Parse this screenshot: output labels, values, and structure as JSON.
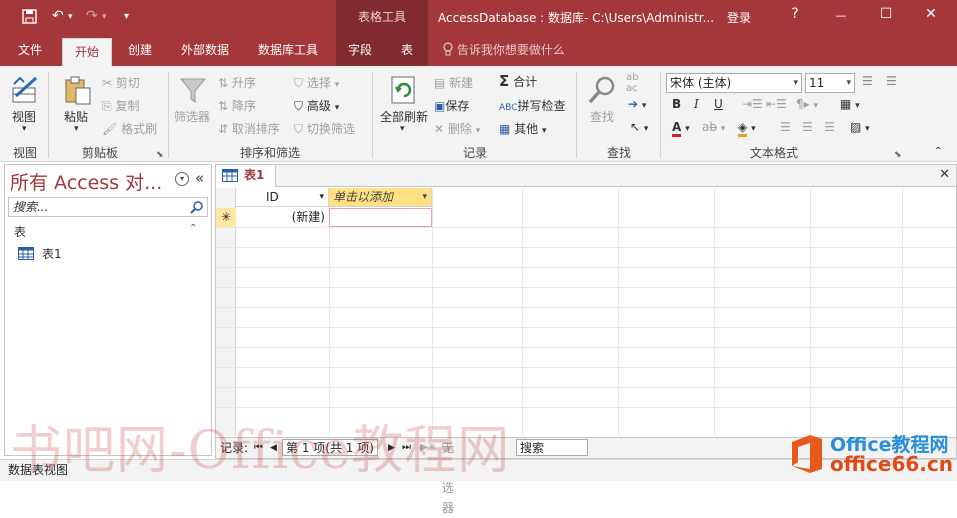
{
  "titlebar": {
    "context_tab": "表格工具",
    "title": "AccessDatabase : 数据库- C:\\Users\\Administr...",
    "login": "登录",
    "help": "?",
    "undo_glyph": "↶",
    "redo_glyph": "↷",
    "qat_more": "▾",
    "min": "—",
    "max": "☐",
    "close": "✕"
  },
  "tabs": [
    "文件",
    "开始",
    "创建",
    "外部数据",
    "数据库工具",
    "字段",
    "表"
  ],
  "tellme": "告诉我你想要做什么",
  "ribbon": {
    "groups": {
      "view": "视图",
      "clipboard": "剪贴板",
      "sortfilter": "排序和筛选",
      "records": "记录",
      "find": "查找",
      "textformat": "文本格式"
    },
    "view_btn": "视图",
    "paste": "粘贴",
    "cut": "剪切",
    "copy": "复制",
    "format_painter": "格式刷",
    "filter": "筛选器",
    "asc": "升序",
    "desc": "降序",
    "remove_sort": "取消排序",
    "selection": "选择",
    "advanced": "高级",
    "toggle_filter": "切换筛选",
    "refresh": "全部刷新",
    "new": "新建",
    "save": "保存",
    "delete": "删除",
    "totals": "合计",
    "spelling": "拼写检查",
    "more": "其他",
    "find": "查找",
    "font": "宋体 (主体)",
    "fontsize": "11",
    "bold": "B",
    "italic": "I",
    "underline": "U",
    "font_color_glyph": "A"
  },
  "nav": {
    "title": "所有 Access 对...",
    "dropdown_glyph": "▾",
    "collapse_glyph": "«",
    "search_placeholder": "搜索...",
    "section": "表",
    "section_arrow": "⌃",
    "items": [
      "表1"
    ]
  },
  "doc": {
    "tab": "表1",
    "close": "✕",
    "headers": [
      "ID",
      "单击以添加"
    ],
    "new_row_marker": "✳",
    "new_row_value": "(新建)"
  },
  "recbar": {
    "label": "记录:",
    "first": "⏮",
    "prev": "◀",
    "position": "第 1 项(共 1 项)",
    "next": "▶",
    "last": "⏭",
    "filter": "无筛选器",
    "search": "搜索"
  },
  "status": "数据表视图",
  "watermark": {
    "left": "书吧网-Office教程网",
    "right_l1": "Office教程网",
    "right_l2": "office66.cn"
  },
  "colors": {
    "accent": "#a4373a",
    "context": "#822b2e",
    "add_header": "#ffe083",
    "new_row": "#ffe7a2"
  }
}
